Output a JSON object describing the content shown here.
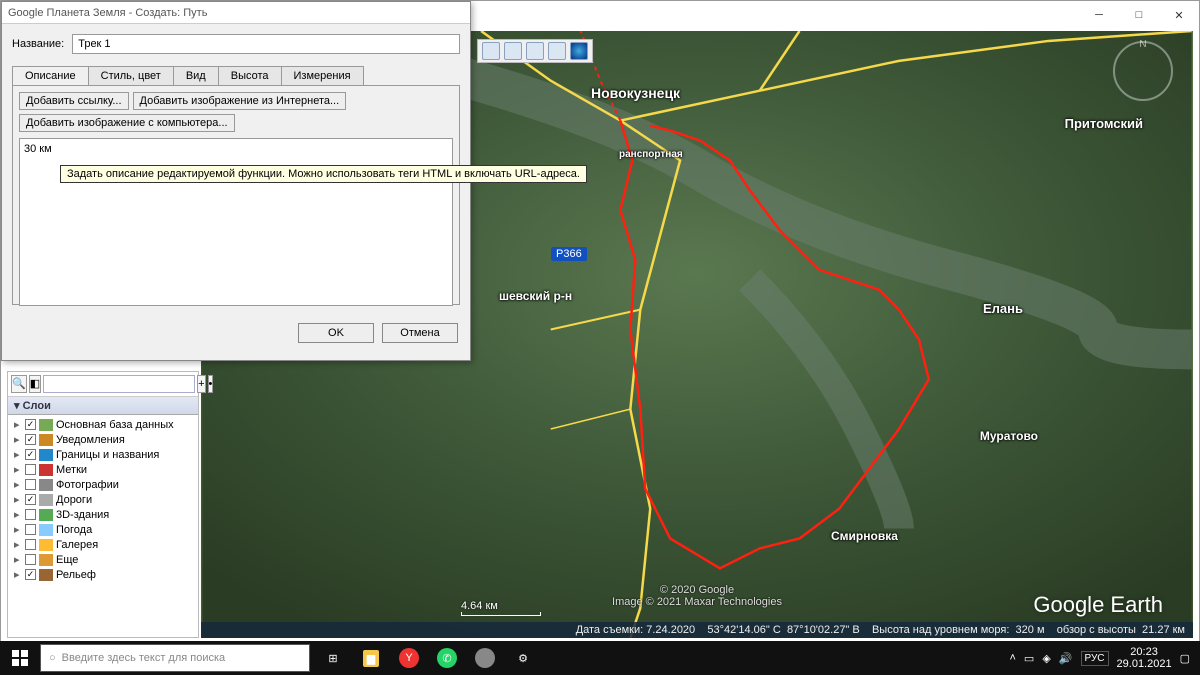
{
  "dialog": {
    "title": "Google Планета Земля - Создать: Путь",
    "name_label": "Название:",
    "name_value": "Трек 1",
    "tabs": [
      "Описание",
      "Стиль, цвет",
      "Вид",
      "Высота",
      "Измерения"
    ],
    "buttons": {
      "add_link": "Добавить ссылку...",
      "add_web_image": "Добавить изображение из Интернета...",
      "add_local_image": "Добавить изображение с компьютера..."
    },
    "desc_text": "30 км",
    "tooltip": "Задать описание редактируемой функции. Можно использовать теги HTML и включать URL-адреса.",
    "ok": "OK",
    "cancel": "Отмена"
  },
  "layers": {
    "header": "Слои",
    "items": [
      {
        "label": "Основная база данных",
        "checked": true,
        "icon": "db"
      },
      {
        "label": "Уведомления",
        "checked": true,
        "icon": "bell"
      },
      {
        "label": "Границы и названия",
        "checked": true,
        "icon": "borders"
      },
      {
        "label": "Метки",
        "checked": false,
        "icon": "marker"
      },
      {
        "label": "Фотографии",
        "checked": false,
        "icon": "photo"
      },
      {
        "label": "Дороги",
        "checked": true,
        "icon": "road"
      },
      {
        "label": "3D-здания",
        "checked": false,
        "icon": "3d"
      },
      {
        "label": "Погода",
        "checked": false,
        "icon": "weather"
      },
      {
        "label": "Галерея",
        "checked": false,
        "icon": "gallery"
      },
      {
        "label": "Еще",
        "checked": false,
        "icon": "more"
      },
      {
        "label": "Рельеф",
        "checked": true,
        "icon": "terrain"
      }
    ]
  },
  "map": {
    "cities": {
      "novokuznetsk": "Новокузнецк",
      "pritomsky": "Притомский",
      "yelan": "Елань",
      "muratovo": "Муратово",
      "smirnovka": "Смирновка",
      "shevsky": "шевский р-н",
      "transportnaya": "ранспортная"
    },
    "route_badge": "Р366",
    "scale": "4.64 км",
    "copyright1": "© 2020 Google",
    "copyright2": "Image © 2021 Maxar Technologies",
    "logo": "Google Earth",
    "status": {
      "date_label": "Дата съемки:",
      "date": "7.24.2020",
      "lat": "53°42'14.06\" С",
      "lon": "87°10'02.27\" В",
      "elev_label": "Высота над уровнем моря:",
      "elev": "320 м",
      "alt_label": "обзор с высоты",
      "alt": "21.27 км"
    }
  },
  "taskbar": {
    "search_placeholder": "Введите здесь текст для поиска",
    "lang": "РУС",
    "time": "20:23",
    "date": "29.01.2021"
  }
}
